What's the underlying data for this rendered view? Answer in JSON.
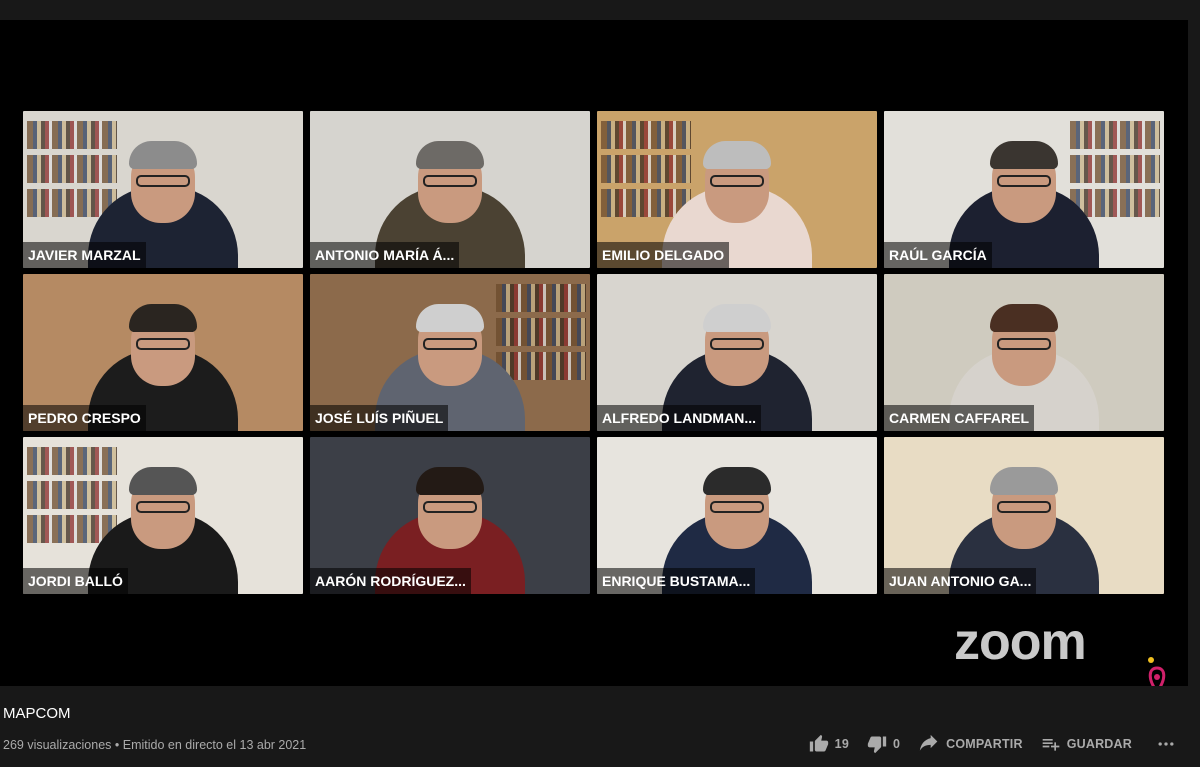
{
  "video": {
    "logo_text": "zoom",
    "participants": [
      {
        "name": "JAVIER MARZAL",
        "bg": "#d9d6cf",
        "shirt": "#1d2333",
        "hair": "#8c8c8c",
        "shelves": true
      },
      {
        "name": "ANTONIO MARÍA Á...",
        "bg": "#d6d4cf",
        "shirt": "#4b4233",
        "hair": "#6d6a66",
        "shelves": false
      },
      {
        "name": "EMILIO DELGADO",
        "bg": "#caa36a",
        "shirt": "#e9d8d0",
        "hair": "#bdbdbd",
        "shelves": true
      },
      {
        "name": "RAÚL GARCÍA",
        "bg": "#e2e0da",
        "shirt": "#1c2030",
        "hair": "#3a3530",
        "shelves": true
      },
      {
        "name": "PEDRO CRESPO",
        "bg": "#b58a63",
        "shirt": "#1c1c1c",
        "hair": "#2a2520",
        "shelves": false
      },
      {
        "name": "JOSÉ LUÍS PIÑUEL",
        "bg": "#8c6a4b",
        "shirt": "#5f6470",
        "hair": "#cfcfcf",
        "shelves": true
      },
      {
        "name": "ALFREDO LANDMAN...",
        "bg": "#d8d5cf",
        "shirt": "#1f2330",
        "hair": "#cfcfcf",
        "shelves": false
      },
      {
        "name": "CARMEN CAFFAREL",
        "bg": "#cfcbbf",
        "shirt": "#d6d2cc",
        "hair": "#4a2f22",
        "shelves": false
      },
      {
        "name": "JORDI BALLÓ",
        "bg": "#e6e2da",
        "shirt": "#1a1a1a",
        "hair": "#555",
        "shelves": true
      },
      {
        "name": "AARÓN RODRÍGUEZ...",
        "bg": "#3c3f47",
        "shirt": "#7a1f22",
        "hair": "#231a15",
        "shelves": false
      },
      {
        "name": "ENRIQUE BUSTAMA...",
        "bg": "#e7e4de",
        "shirt": "#1f2a44",
        "hair": "#2b2b2b",
        "shelves": false
      },
      {
        "name": "JUAN ANTONIO GA...",
        "bg": "#e8dcc4",
        "shirt": "#2a3040",
        "hair": "#9a9a9a",
        "shelves": false
      }
    ]
  },
  "info": {
    "title": "MAPCOM",
    "views": "269 visualizaciones",
    "separator": "•",
    "streamed": "Emitido en directo el 13 abr 2021",
    "likes": "19",
    "dislikes": "0",
    "share_label": "COMPARTIR",
    "save_label": "GUARDAR"
  },
  "colors": {
    "page_bg": "#181818",
    "text_primary": "#ffffff",
    "text_secondary": "#aaaaaa"
  }
}
